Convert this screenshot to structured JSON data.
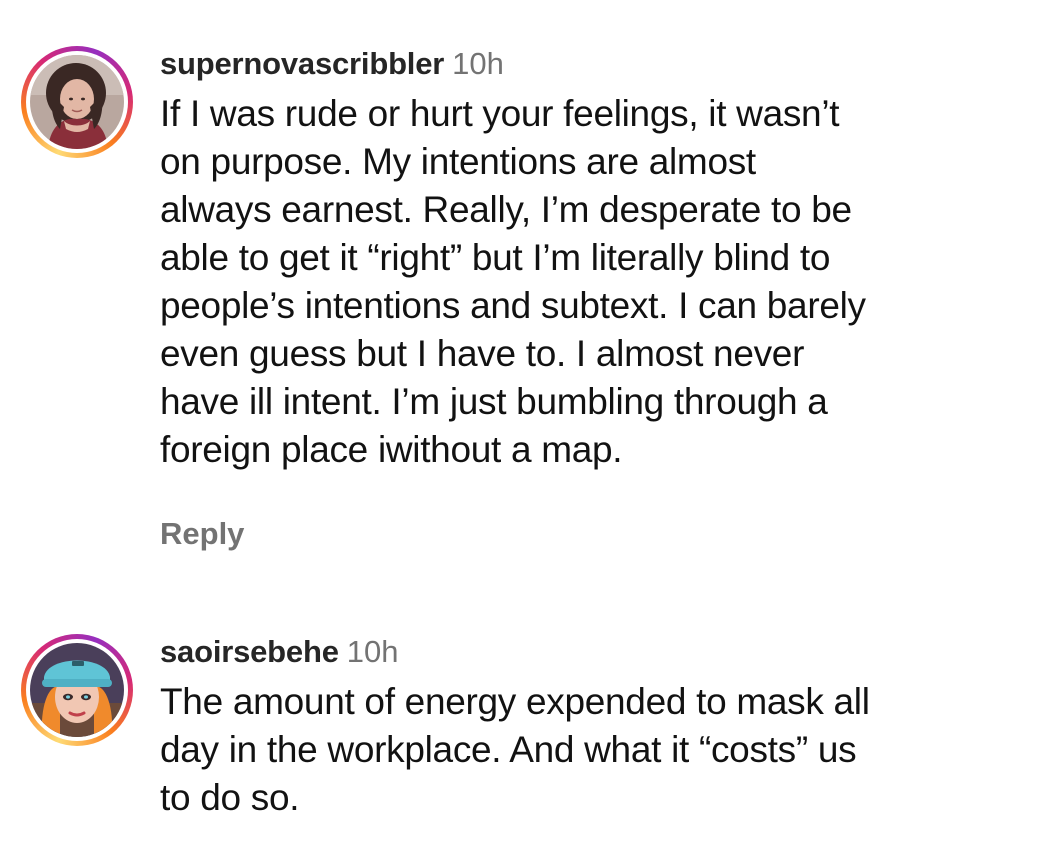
{
  "comments": [
    {
      "username": "supernovascribbler",
      "time": "10h",
      "avatar": "profile-photo-woman-dark-hair",
      "lines": [
        "If I was rude or hurt your feelings, it wasn’t",
        "on purpose. My intentions are almost",
        "always earnest. Really, I’m desperate to be",
        "able to get it “right” but I’m literally blind to",
        "people’s intentions and subtext. I can barely",
        "even guess but I have to. I almost never",
        "have ill intent. I’m just bumbling through a",
        "foreign place iwithout a map."
      ],
      "reply_label": "Reply"
    },
    {
      "username": "saoirsebehe",
      "time": "10h",
      "avatar": "profile-illustration-teal-cap",
      "lines": [
        "The amount of energy expended to mask all",
        "day in the workplace. And what it “costs” us",
        "to do so."
      ]
    }
  ],
  "colors": {
    "username": "#262626",
    "timestamp": "#737373",
    "reply": "#737373",
    "story_ring": [
      "#feda75",
      "#fa7e1e",
      "#d62976",
      "#962fbf"
    ]
  }
}
